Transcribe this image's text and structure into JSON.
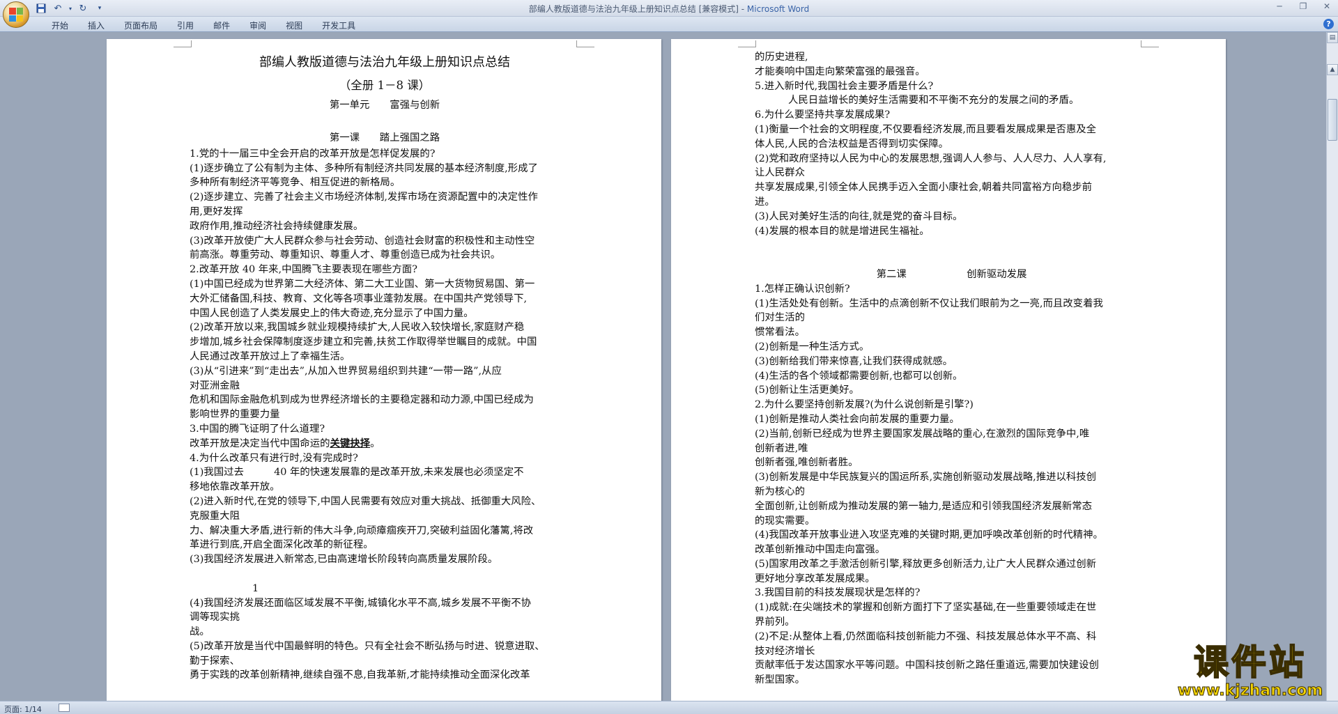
{
  "window": {
    "title_doc": "部编人教版道德与法治九年级上册知识点总结 [兼容模式] - ",
    "title_app": "Microsoft Word"
  },
  "ribbon": {
    "tabs": [
      "开始",
      "插入",
      "页面布局",
      "引用",
      "邮件",
      "审阅",
      "视图",
      "开发工具"
    ]
  },
  "status": {
    "page": "页面: 1/14"
  },
  "watermark": {
    "brand": "课件站",
    "url": "www.kjzhan.com"
  },
  "page_left": {
    "title": "部编人教版道德与法治九年级上册知识点总结",
    "subtitle": "（全册 1－8 课）",
    "unit": "第一单元　　富强与创新",
    "lesson": "第一课　　踏上强国之路",
    "lines": [
      "1.党的十一届三中全会开启的改革开放是怎样促发展的?",
      "(1)逐步确立了公有制为主体、多种所有制经济共同发展的基本经济制度,形成了",
      "多种所有制经济平等竞争、相互促进的新格局。",
      "(2)逐步建立、完善了社会主义市场经济体制,发挥市场在资源配置中的决定性作",
      "用,更好发挥",
      "政府作用,推动经济社会持续健康发展。",
      "(3)改革开放使广大人民群众参与社会劳动、创造社会财富的积极性和主动性空",
      "前高涨。尊重劳动、尊重知识、尊重人才、尊重创造已成为社会共识。",
      "2.改革开放 40 年来,中国腾飞主要表现在哪些方面?",
      "(1)中国已经成为世界第二大经济体、第二大工业国、第一大货物贸易国、第一",
      "大外汇储备国,科技、教育、文化等各项事业蓬勃发展。在中国共产党领导下,",
      "中国人民创造了人类发展史上的伟大奇迹,充分显示了中国力量。",
      "(2)改革开放以来,我国城乡就业规模持续扩大,人民收入较快增长,家庭财产稳",
      "步增加,城乡社会保障制度逐步建立和完善,扶贫工作取得举世瞩目的成就。中国",
      "人民通过改革开放过上了幸福生活。",
      "(3)从“引进来”到“走出去”,从加入世界贸易组织到共建“一带一路”,从应",
      "对亚洲金融",
      "危机和国际金融危机到成为世界经济增长的主要稳定器和动力源,中国已经成为",
      "影响世界的重要力量",
      "3.中国的腾飞证明了什么道理?",
      "改革开放是决定当代中国命运的",
      "4.为什么改革只有进行时,没有完成时?",
      "(1)我国过去　　　40 年的快速发展靠的是改革开放,未来发展也必须坚定不",
      "移地依靠改革开放。",
      "(2)进入新时代,在党的领导下,中国人民需要有效应对重大挑战、抵御重大风险、",
      "克服重大阻",
      "力、解决重大矛盾,进行新的伟大斗争,向顽瘴痼疾开刀,突破利益固化藩篱,将改",
      "革进行到底,开启全面深化改革的新征程。",
      "(3)我国经济发展进入新常态,已由高速增长阶段转向高质量发展阶段。"
    ],
    "key_phrase": "关键抉择",
    "page_number": "1",
    "lines_after": [
      "(4)我国经济发展还面临区域发展不平衡,城镇化水平不高,城乡发展不平衡不协",
      "调等现实挑",
      "战。",
      "(5)改革开放是当代中国最鲜明的特色。只有全社会不断弘扬与时进、锐意进取、",
      "勤于探索、",
      "勇于实践的改革创新精神,继续自强不息,自我革新,才能持续推动全面深化改革"
    ]
  },
  "page_right": {
    "lines_a": [
      "的历史进程,",
      "才能奏响中国走向繁荣富强的最强音。",
      "5.进入新时代,我国社会主要矛盾是什么?"
    ],
    "indent_line": "人民日益增长的美好生活需要和不平衡不充分的发展之间的矛盾。",
    "lines_b": [
      "6.为什么要坚持共享发展成果?",
      "(1)衡量一个社会的文明程度,不仅要看经济发展,而且要看发展成果是否惠及全",
      "体人民,人民的合法权益是否得到切实保障。",
      "(2)党和政府坚持以人民为中心的发展思想,强调人人参与、人人尽力、人人享有,",
      "让人民群众",
      "共享发展成果,引领全体人民携手迈入全面小康社会,朝着共同富裕方向稳步前",
      "进。",
      "(3)人民对美好生活的向往,就是党的奋斗目标。",
      "(4)发展的根本目的就是增进民生福祉。"
    ],
    "lesson2": "第二课　　　　　　创新驱动发展",
    "lines_c": [
      "1.怎样正确认识创新?",
      "(1)生活处处有创新。生活中的点滴创新不仅让我们眼前为之一亮,而且改变着我",
      "们对生活的",
      "惯常看法。",
      "(2)创新是一种生活方式。",
      "(3)创新给我们带来惊喜,让我们获得成就感。",
      "(4)生活的各个领域都需要创新,也都可以创新。",
      "(5)创新让生活更美好。",
      "2.为什么要坚持创新发展?(为什么说创新是引擎?)",
      "(1)创新是推动人类社会向前发展的重要力量。",
      "(2)当前,创新已经成为世界主要国家发展战略的重心,在激烈的国际竞争中,唯",
      "创新者进,唯",
      "创新者强,唯创新者胜。",
      "(3)创新发展是中华民族复兴的国运所系,实施创新驱动发展战略,推进以科技创",
      "新为核心的",
      "全面创新,让创新成为推动发展的第一轴力,是适应和引领我国经济发展新常态",
      "的现实需要。",
      "(4)我国改革开放事业进入攻坚克难的关键时期,更加呼唤改革创新的时代精神。",
      "改革创新推动中国走向富强。",
      "(5)国家用改革之手激活创新引擎,释放更多创新活力,让广大人民群众通过创新",
      "更好地分享改革发展成果。",
      "3.我国目前的科技发展现状是怎样的?",
      "(1)成就:在尖端技术的掌握和创新方面打下了坚实基础,在一些重要领域走在世",
      "界前列。",
      "(2)不足:从整体上看,仍然面临科技创新能力不强、科技发展总体水平不高、科",
      "技对经济增长",
      "贡献率低于发达国家水平等问题。中国科技创新之路任重道远,需要加快建设创",
      "新型国家。"
    ]
  }
}
